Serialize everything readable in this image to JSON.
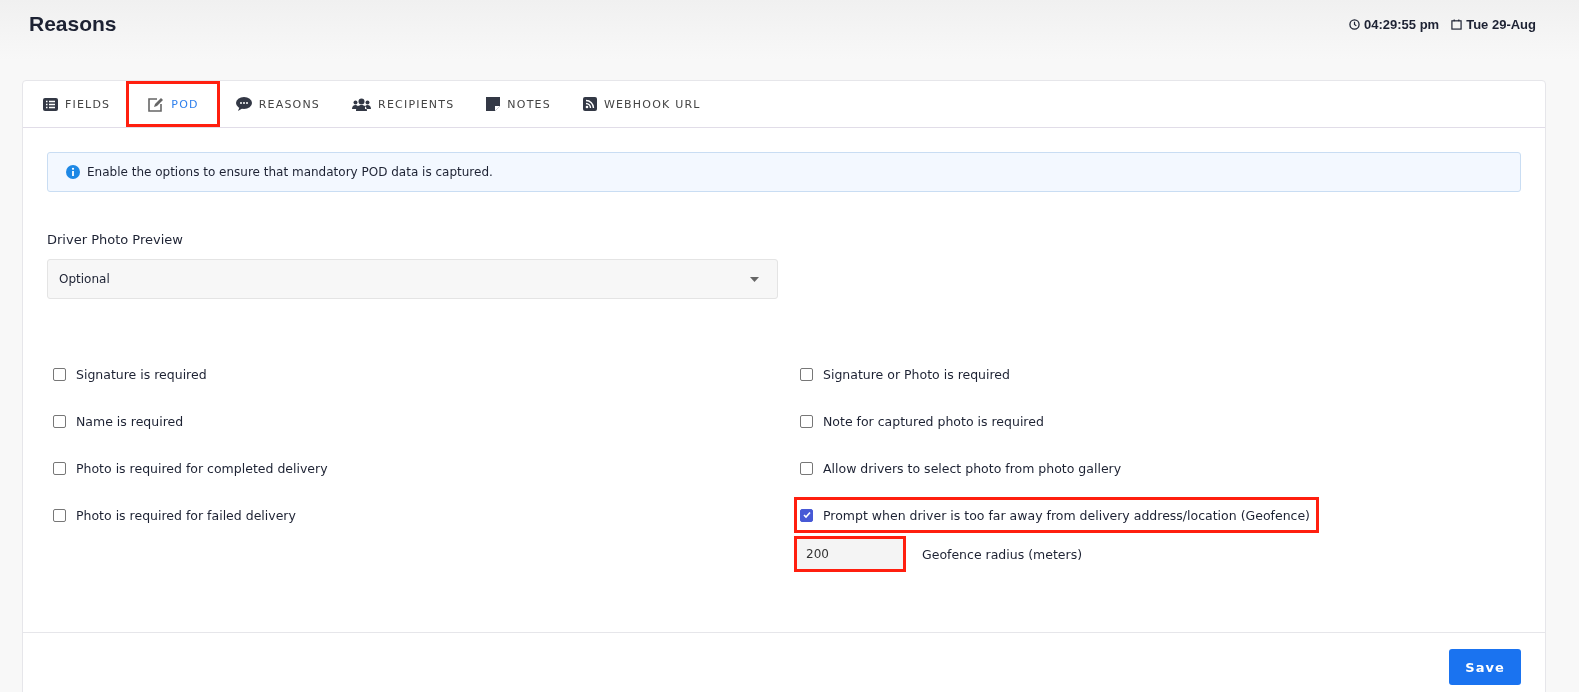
{
  "page_title": "Reasons",
  "clock": {
    "time": "04:29:55 pm",
    "date": "Tue 29-Aug"
  },
  "tabs": [
    {
      "label": "FIELDS",
      "kind": "list",
      "selected": false,
      "highlighted": false
    },
    {
      "label": "POD",
      "kind": "edit",
      "selected": true,
      "highlighted": true
    },
    {
      "label": "REASONS",
      "kind": "chat",
      "selected": false,
      "highlighted": false
    },
    {
      "label": "RECIPIENTS",
      "kind": "users",
      "selected": false,
      "highlighted": false
    },
    {
      "label": "NOTES",
      "kind": "note",
      "selected": false,
      "highlighted": false
    },
    {
      "label": "WEBHOOK URL",
      "kind": "rss",
      "selected": false,
      "highlighted": false
    }
  ],
  "info": "Enable the options to ensure that mandatory POD data is captured.",
  "photo_preview": {
    "label": "Driver Photo Preview",
    "value": "Optional"
  },
  "left_options": [
    {
      "label": "Signature is required",
      "checked": false,
      "highlighted": false
    },
    {
      "label": "Name is required",
      "checked": false,
      "highlighted": false
    },
    {
      "label": "Photo is required for completed delivery",
      "checked": false,
      "highlighted": false
    },
    {
      "label": "Photo is required for failed delivery",
      "checked": false,
      "highlighted": false
    }
  ],
  "right_options": [
    {
      "label": "Signature or Photo is required",
      "checked": false,
      "highlighted": false
    },
    {
      "label": "Note for captured photo is required",
      "checked": false,
      "highlighted": false
    },
    {
      "label": "Allow drivers to select photo from photo gallery",
      "checked": false,
      "highlighted": false
    },
    {
      "label": "Prompt when driver is too far away from delivery address/location (Geofence)",
      "checked": true,
      "highlighted": true
    }
  ],
  "geofence": {
    "value": "200",
    "label": "Geofence radius (meters)",
    "highlighted": true
  },
  "save_button": "Save"
}
